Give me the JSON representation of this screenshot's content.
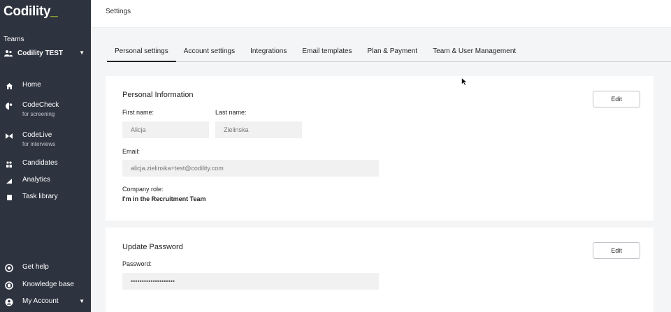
{
  "sidebar": {
    "logo": "Codility",
    "teams_label": "Teams",
    "team_name": "Codility TEST",
    "nav": [
      {
        "label": "Home",
        "sub": ""
      },
      {
        "label": "CodeCheck",
        "sub": "for screening"
      },
      {
        "label": "CodeLive",
        "sub": "for interviews"
      },
      {
        "label": "Candidates",
        "sub": ""
      },
      {
        "label": "Analytics",
        "sub": ""
      },
      {
        "label": "Task library",
        "sub": ""
      }
    ],
    "bottom": [
      {
        "label": "Get help"
      },
      {
        "label": "Knowledge base"
      },
      {
        "label": "My Account"
      }
    ]
  },
  "header": {
    "breadcrumb": "Settings"
  },
  "tabs": [
    {
      "label": "Personal settings",
      "active": true
    },
    {
      "label": "Account settings",
      "active": false
    },
    {
      "label": "Integrations",
      "active": false
    },
    {
      "label": "Email templates",
      "active": false
    },
    {
      "label": "Plan & Payment",
      "active": false
    },
    {
      "label": "Team & User Management",
      "active": false
    }
  ],
  "personal_info": {
    "title": "Personal Information",
    "edit_label": "Edit",
    "first_name_label": "First name:",
    "first_name_value": "Alicja",
    "last_name_label": "Last name:",
    "last_name_value": "Zielinska",
    "email_label": "Email:",
    "email_value": "alicja.zielinska+test@codility.com",
    "role_label": "Company role:",
    "role_value": "I'm in the Recruitment Team"
  },
  "password": {
    "title": "Update Password",
    "edit_label": "Edit",
    "password_label": "Password:",
    "password_value": "••••••••••••••••••••"
  },
  "colors": {
    "sidebar_bg": "#2d333f",
    "accent": "#c8e02a",
    "page_bg": "#f4f5f7"
  }
}
